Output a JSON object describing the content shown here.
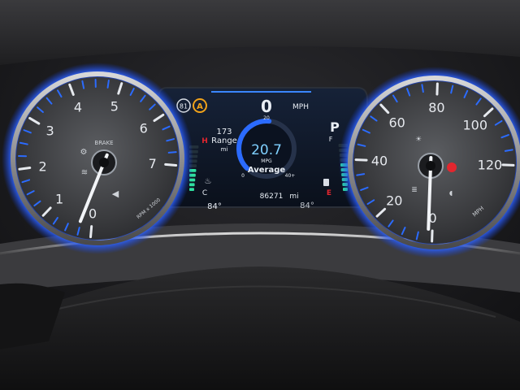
{
  "tachometer": {
    "tick_labels": [
      "0",
      "1",
      "2",
      "3",
      "4",
      "5",
      "6",
      "7"
    ],
    "center_label": "BRAKE",
    "unit_label": "RPM x 1000",
    "value_rpm_x1000": 0.5,
    "max": 8
  },
  "speedometer": {
    "tick_labels": [
      "0",
      "20",
      "40",
      "60",
      "80",
      "100",
      "120"
    ],
    "unit_label": "MPH",
    "value_mph": 0,
    "max": 140
  },
  "display": {
    "speed": "0",
    "speed_unit": "MPH",
    "gear": "P",
    "range_value": "173",
    "range_label": "Range",
    "range_unit": "mi",
    "mpg_value": "20.7",
    "mpg_unit": "MPG",
    "mpg_label": "Average",
    "mpg_scale": {
      "min": "0",
      "mid": "20",
      "max": "40+"
    },
    "mpg_fraction": 0.52,
    "odometer_value": "86271",
    "odometer_unit": "mi",
    "outside_temp_left": "84°",
    "outside_temp_right": "84°",
    "temp_gauge": {
      "hot": "H",
      "cold": "C",
      "level": 0.55
    },
    "fuel_gauge": {
      "full": "F",
      "empty": "E",
      "level": 0.6
    },
    "autohold_icon_text": "A",
    "left_indicator_text": "81"
  },
  "colors": {
    "accent_blue": "#2b6bff",
    "lcd_background": "#0d1524",
    "needle": "#f2f4f7",
    "warning_red": "#e3262e",
    "warning_amber": "#f0a21a",
    "gauge_green": "#2fe0a0"
  }
}
